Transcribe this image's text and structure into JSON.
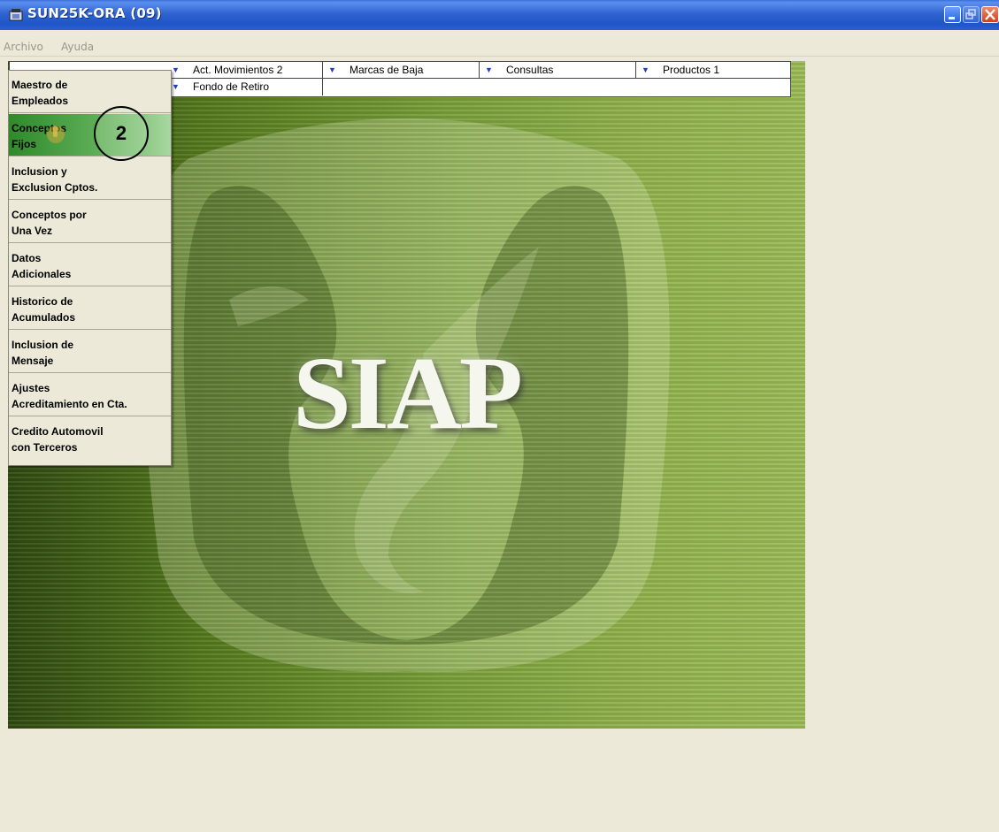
{
  "window": {
    "title": "SUN25K-ORA  (09)"
  },
  "menubar": {
    "items": [
      "Archivo",
      "Ayuda"
    ]
  },
  "tabs": {
    "row1": [
      "Act. Movimientos 2",
      "Marcas de Baja",
      "Consultas",
      "Productos 1"
    ],
    "row2": [
      "Fondo de Retiro"
    ]
  },
  "dropdown": {
    "items": [
      {
        "line1": "Maestro de",
        "line2": "Empleados"
      },
      {
        "line1": "Conceptos",
        "line2": "Fijos"
      },
      {
        "line1": "Inclusion y",
        "line2": "Exclusion Cptos."
      },
      {
        "line1": "Conceptos por",
        "line2": "Una Vez"
      },
      {
        "line1": "Datos",
        "line2": "Adicionales"
      },
      {
        "line1": "Historico de",
        "line2": "Acumulados"
      },
      {
        "line1": "Inclusion de",
        "line2": "Mensaje"
      },
      {
        "line1": "Ajustes",
        "line2": "Acreditamiento en Cta."
      },
      {
        "line1": "Credito Automovil",
        "line2": "con Terceros"
      }
    ],
    "highlighted_index": 1
  },
  "callout": {
    "number": "2"
  },
  "banner": {
    "logo_text": "SIAP"
  },
  "colors": {
    "titlebar": "#2f63cf",
    "background": "#ece9d8",
    "banner_green": "#7aa03a",
    "highlight": "#5fae58"
  }
}
